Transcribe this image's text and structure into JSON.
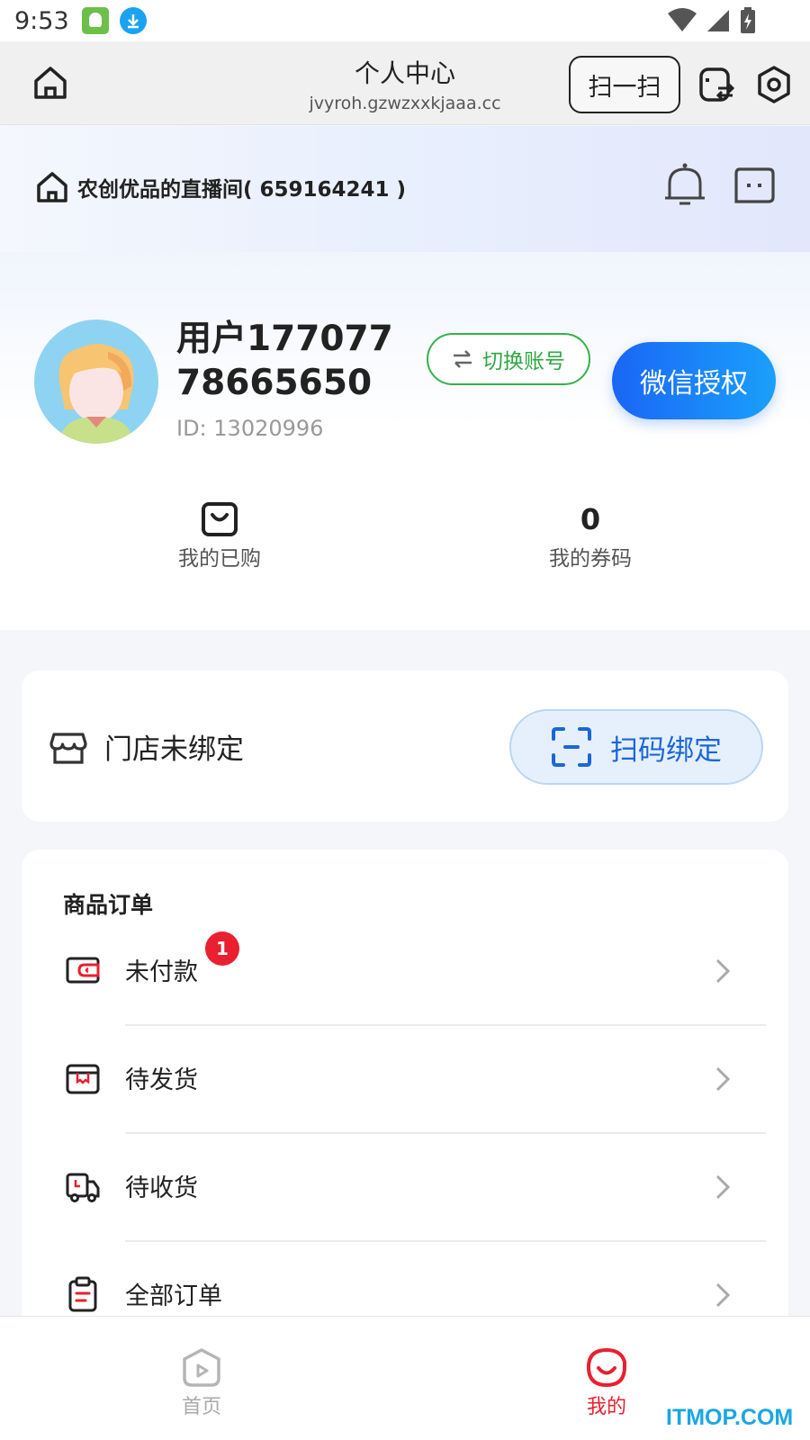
{
  "status_bar": {
    "time": "9:53"
  },
  "top_nav": {
    "title": "个人中心",
    "url": "jvyroh.gzwzxxkjaaa.cc",
    "scan_label": "扫一扫"
  },
  "profile": {
    "live_room": "农创优品的直播间( 659164241 )",
    "username": "用户17707778665650",
    "user_id": "ID: 13020996",
    "switch_account_label": "切换账号",
    "wechat_auth_label": "微信授权",
    "stats": {
      "purchased_label": "我的已购",
      "coupon_count": "0",
      "coupon_label": "我的券码"
    }
  },
  "store": {
    "status_label": "门店未绑定",
    "scan_bind_label": "扫码绑定"
  },
  "orders": {
    "title": "商品订单",
    "items": [
      {
        "label": "未付款",
        "badge": "1"
      },
      {
        "label": "待发货"
      },
      {
        "label": "待收货"
      },
      {
        "label": "全部订单"
      }
    ]
  },
  "tab_bar": {
    "home_label": "首页",
    "mine_label": "我的"
  },
  "watermark": "ITMOP.COM",
  "colors": {
    "accent_blue": "#1a66f5",
    "accent_green": "#2ea843",
    "accent_red": "#e8202f"
  }
}
